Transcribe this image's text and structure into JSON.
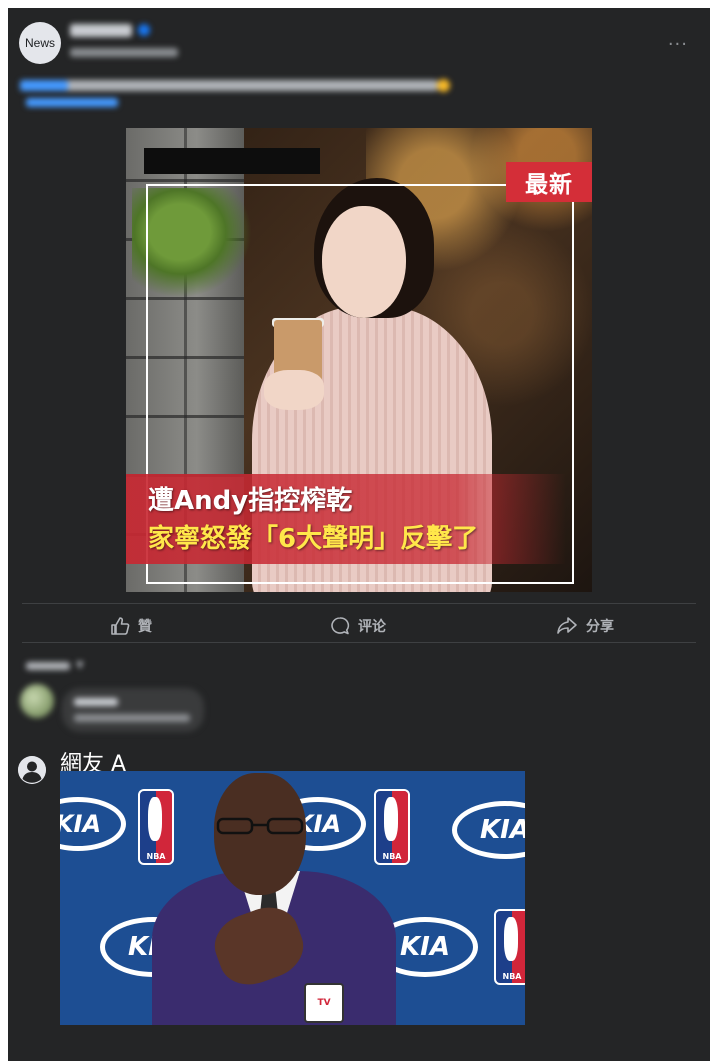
{
  "post": {
    "avatar_label": "News",
    "image": {
      "badge": "最新",
      "headline_line1": "遭Andy指控榨乾",
      "headline_line2": "家寧怒發「6大聲明」反擊了"
    }
  },
  "actions": {
    "like": "贊",
    "comment": "评论",
    "share": "分享"
  },
  "reply": {
    "user_name": "網友 A",
    "image_logos": {
      "kia": "KIA",
      "nba": "NBA",
      "mic": "TV"
    }
  },
  "colors": {
    "background": "#242526",
    "badge_red": "#d42e38",
    "headline_yellow": "#ffe74a",
    "secondary_text": "#b0b3b8"
  }
}
